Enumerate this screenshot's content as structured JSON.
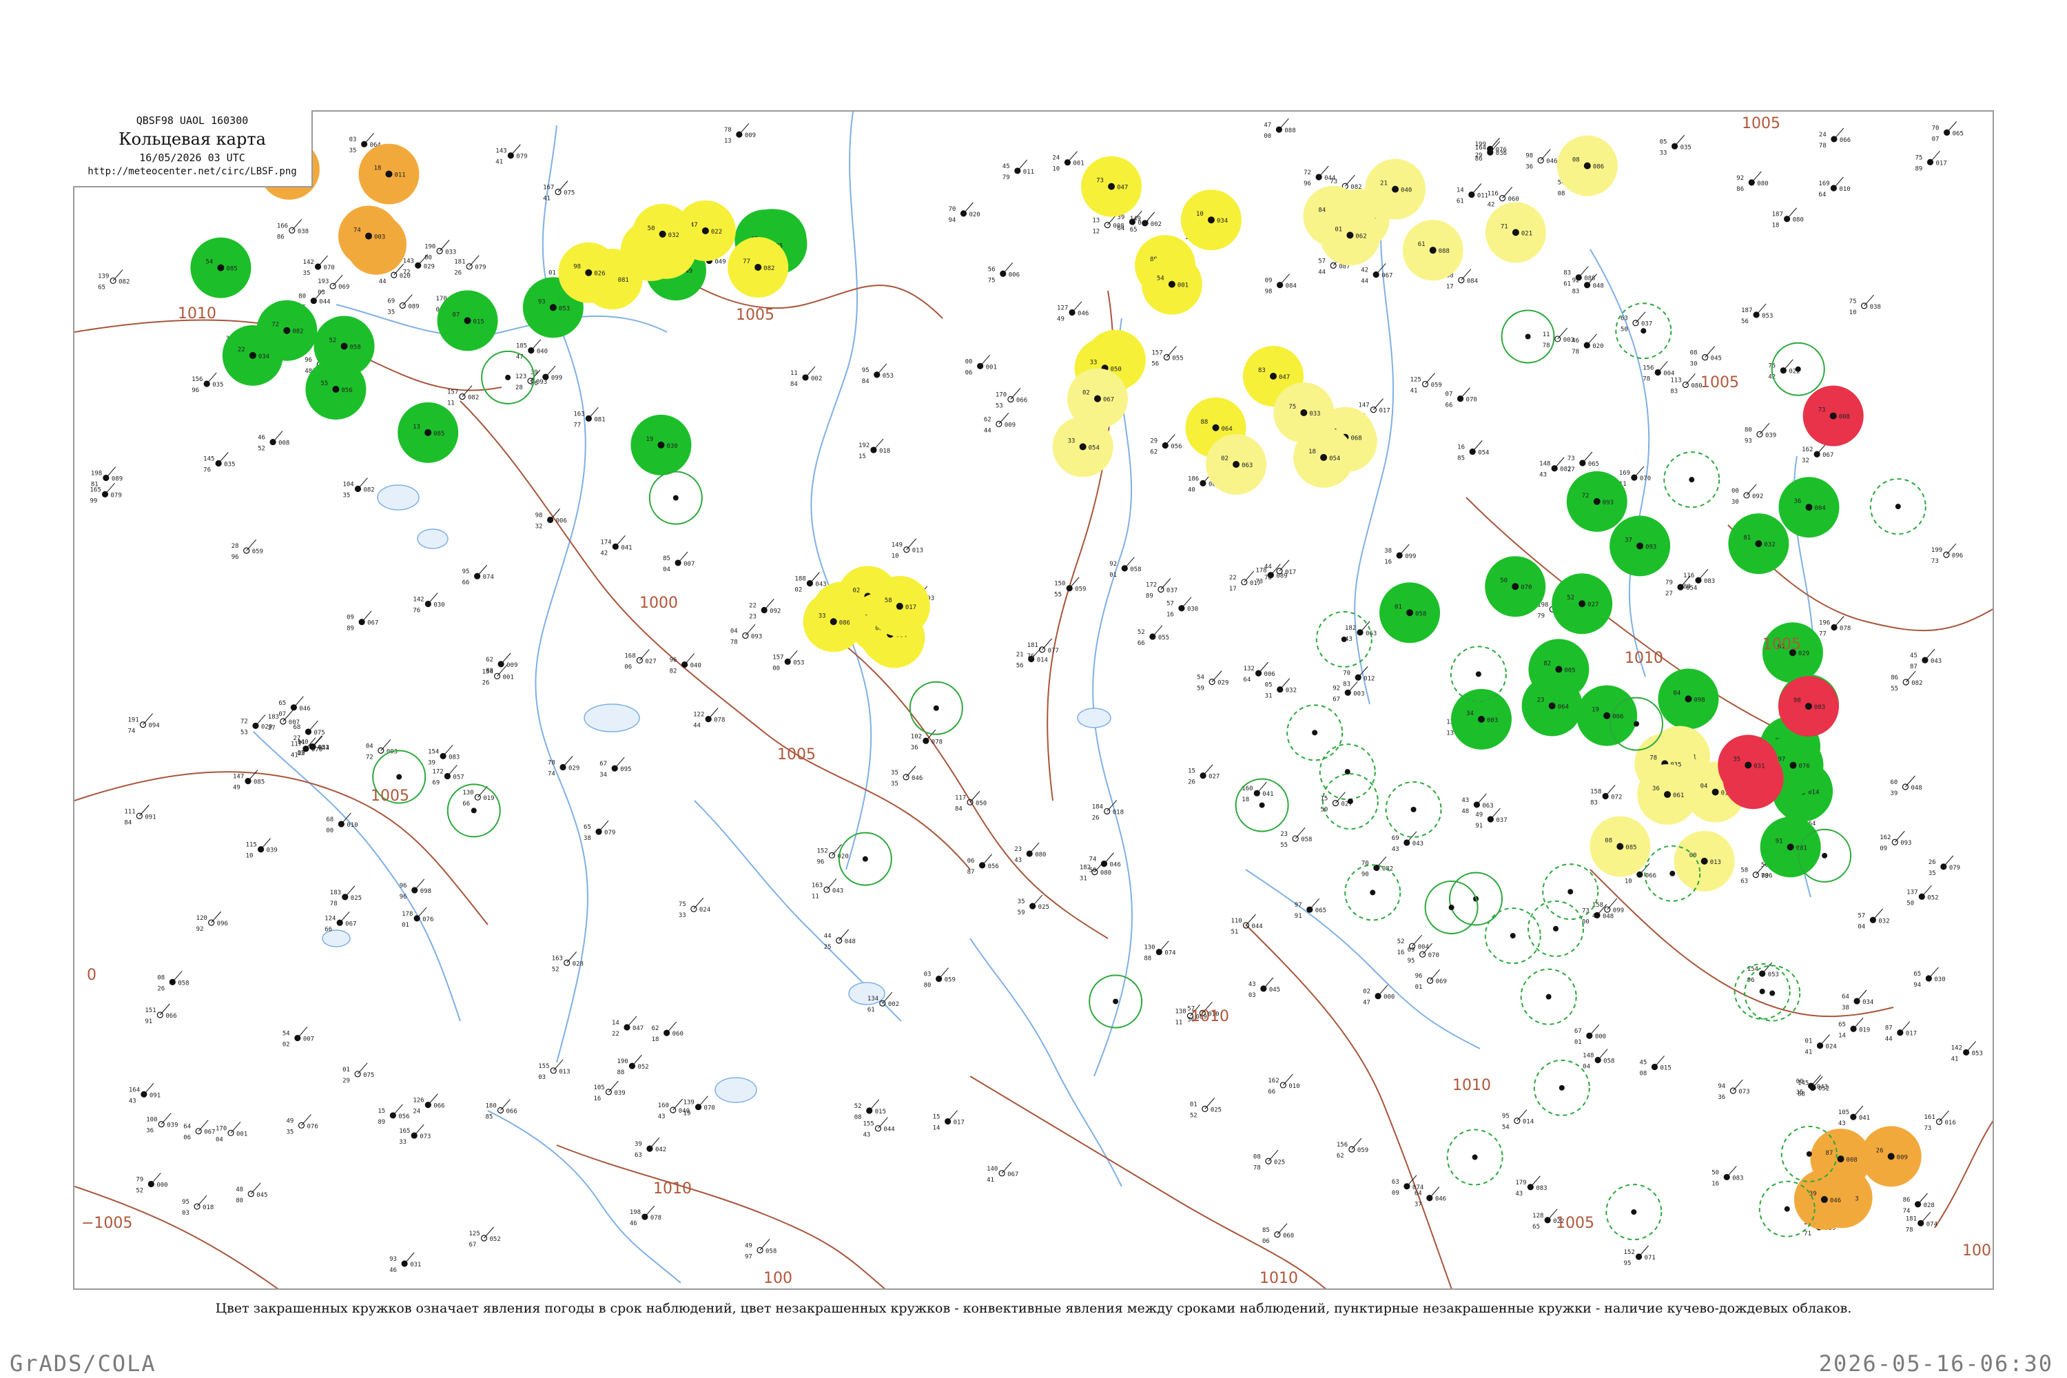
{
  "title_box": {
    "header": "QBSF98  UAOL  160300",
    "title": "Кольцевая карта",
    "datetime": "16/05/2026 03 UTC",
    "url": "http://meteocenter.net/circ/LBSF.png"
  },
  "caption": "Цвет закрашенных кружков означает явления погоды в срок наблюдений, цвет незакрашенных кружков - конвективные явления между сроками наблюдений, пунктирные незакрашенные кружки - наличие кучево-дождевых облаков.",
  "footer": {
    "left": "GrADS/COLA",
    "right": "2026-05-16-06:30"
  },
  "colors": {
    "green": "#1cbf2a",
    "yellow": "#f6f039",
    "light_yellow": "#f8f48a",
    "orange": "#f2a93c",
    "red": "#e8334a",
    "isobar": "#a8553a",
    "river": "#7fb0e6",
    "border": "#9a9a9a",
    "open_circle": "#2aa83a"
  },
  "isobar_labels": [
    "1010",
    "1005",
    "1000",
    "1005",
    "1005",
    "1010",
    "1010",
    "1010",
    "1005",
    "1010",
    "1005",
    "−1005",
    "1005",
    "100",
    "0",
    "1005",
    "1010",
    "100"
  ],
  "weather_circles": [
    {
      "type": "green-filled",
      "count": 38
    },
    {
      "type": "yellow-filled",
      "count": 22
    },
    {
      "type": "light-yellow-filled",
      "count": 20
    },
    {
      "type": "orange-filled",
      "count": 8
    },
    {
      "type": "red-filled",
      "count": 4
    },
    {
      "type": "open-solid",
      "count": 14
    },
    {
      "type": "open-dashed",
      "count": 22
    }
  ]
}
